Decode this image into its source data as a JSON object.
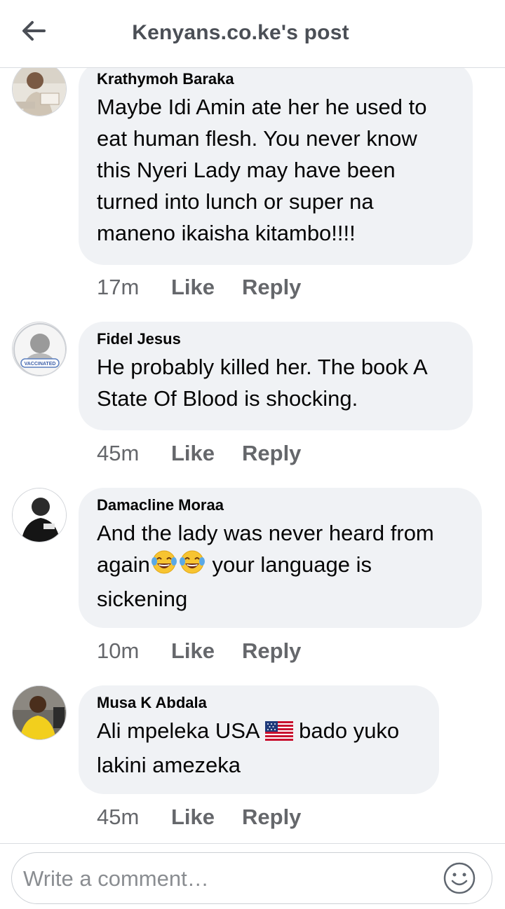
{
  "header": {
    "title": "Kenyans.co.ke's post",
    "back_icon": "arrow-left-icon"
  },
  "comments": [
    {
      "author": "Krathymoh Baraka",
      "text": "Maybe Idi Amin ate her he used to\neat human flesh. You never know\nthis Nyeri Lady may have been\nturned into lunch or super na\nmaneno ikaisha kitambo!!!!",
      "time": "17m",
      "like_label": "Like",
      "reply_label": "Reply"
    },
    {
      "author": "Fidel Jesus",
      "text": "He probably killed her. The book A\nState Of Blood is shocking.",
      "time": "45m",
      "like_label": "Like",
      "reply_label": "Reply"
    },
    {
      "author": "Damacline Moraa",
      "text_part1": "And the lady was never heard from\nagain",
      "text_part2": " your language is\nsickening",
      "emoji": "face-with-tears-of-joy",
      "time": "10m",
      "like_label": "Like",
      "reply_label": "Reply"
    },
    {
      "author": "Musa K Abdala",
      "text_part1": "Ali mpeleka USA ",
      "text_part2": " bado yuko\nlakini amezeka",
      "emoji": "us-flag",
      "time": "45m",
      "like_label": "Like",
      "reply_label": "Reply"
    }
  ],
  "composer": {
    "placeholder": "Write a comment…",
    "smiley_icon": "smiley-icon"
  },
  "colors": {
    "bubble": "#f0f2f5",
    "secondary_text": "#65676b",
    "title_text": "#4b4f56"
  }
}
